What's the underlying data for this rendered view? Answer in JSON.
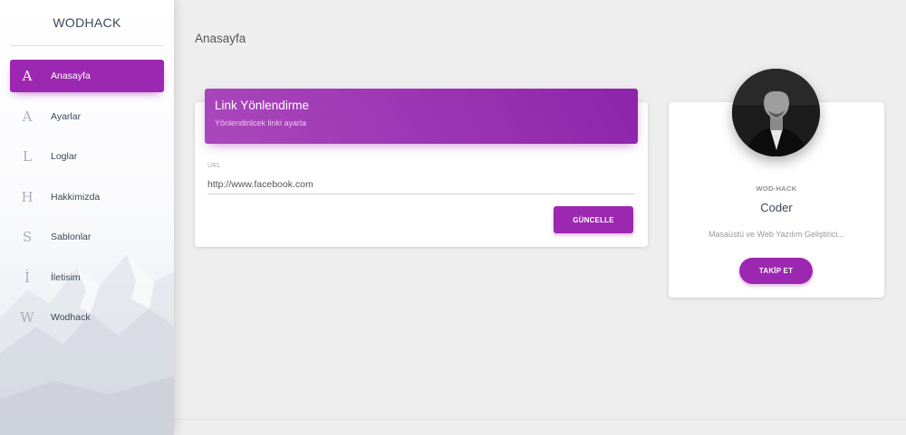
{
  "brand": "WODHACK",
  "sidebar": {
    "items": [
      {
        "letter": "A",
        "label": "Anasayfa",
        "active": true
      },
      {
        "letter": "A",
        "label": "Ayarlar",
        "active": false
      },
      {
        "letter": "L",
        "label": "Loglar",
        "active": false
      },
      {
        "letter": "H",
        "label": "Hakkimizda",
        "active": false
      },
      {
        "letter": "S",
        "label": "Sablonlar",
        "active": false
      },
      {
        "letter": "İ",
        "label": "İletisim",
        "active": false
      },
      {
        "letter": "W",
        "label": "Wodhack",
        "active": false
      }
    ]
  },
  "page": {
    "title": "Anasayfa"
  },
  "link_card": {
    "title": "Link Yönlendirme",
    "subtitle": "Yönlendirilcek linki ayarla",
    "url_label": "URL",
    "url_value": "http://www.facebook.com",
    "update_button": "GÜNCELLE"
  },
  "profile": {
    "category": "WOD-HACK",
    "name": "Coder",
    "description": "Masaüstü ve Web Yazılım Geliştirici...",
    "follow_button": "TAKİP ET"
  },
  "colors": {
    "accent": "#9c27b0",
    "accent_light": "#ab47bc"
  }
}
